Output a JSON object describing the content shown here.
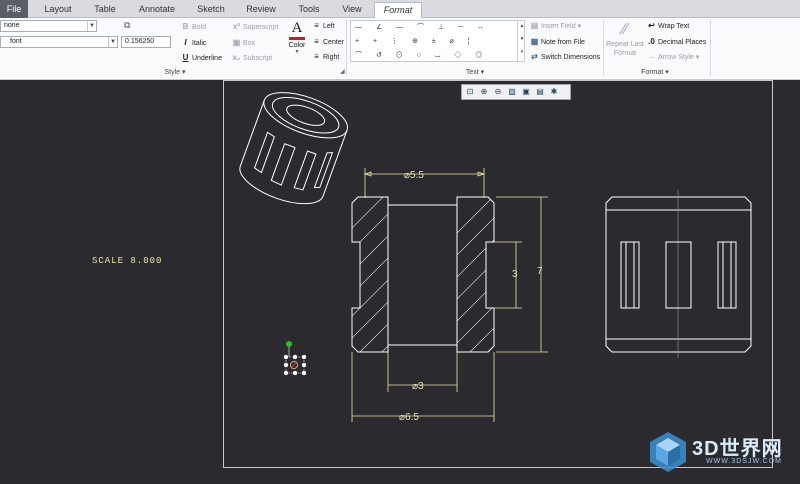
{
  "tabs": [
    "File",
    "Layout",
    "Table",
    "Annotate",
    "Sketch",
    "Review",
    "Tools",
    "View",
    "Format"
  ],
  "style_group": {
    "font_style_value": "none",
    "font_value": "font",
    "height_value": "0.156250",
    "bold": "Bold",
    "italic": "Italic",
    "underline": "Underline",
    "superscript": "Superscript",
    "box": "Box",
    "subscript": "Subscript",
    "color": "Color",
    "left": "Left",
    "center": "Center",
    "right": "Right",
    "label": "Style"
  },
  "text_group": {
    "insert_field": "Insert Field",
    "note_from_file": "Note from File",
    "switch_dimensions": "Switch Dimensions",
    "label": "Text"
  },
  "format_group": {
    "repeat_last_format": "Repeat Last Format",
    "wrap_text": "Wrap Text",
    "decimal_places": "Decimal Places",
    "arrow_style": "Arrow Style",
    "label": "Format"
  },
  "drawing": {
    "scale_text": "SCALE  8.000",
    "dim_top": "⌀5.5",
    "dim_hole": "3",
    "dim_height": "7",
    "dim_bore": "⌀3",
    "dim_bottom": "⌀6.5"
  },
  "watermark": {
    "brand": "3D世界网",
    "url": "WWW.3DSJW.COM"
  }
}
